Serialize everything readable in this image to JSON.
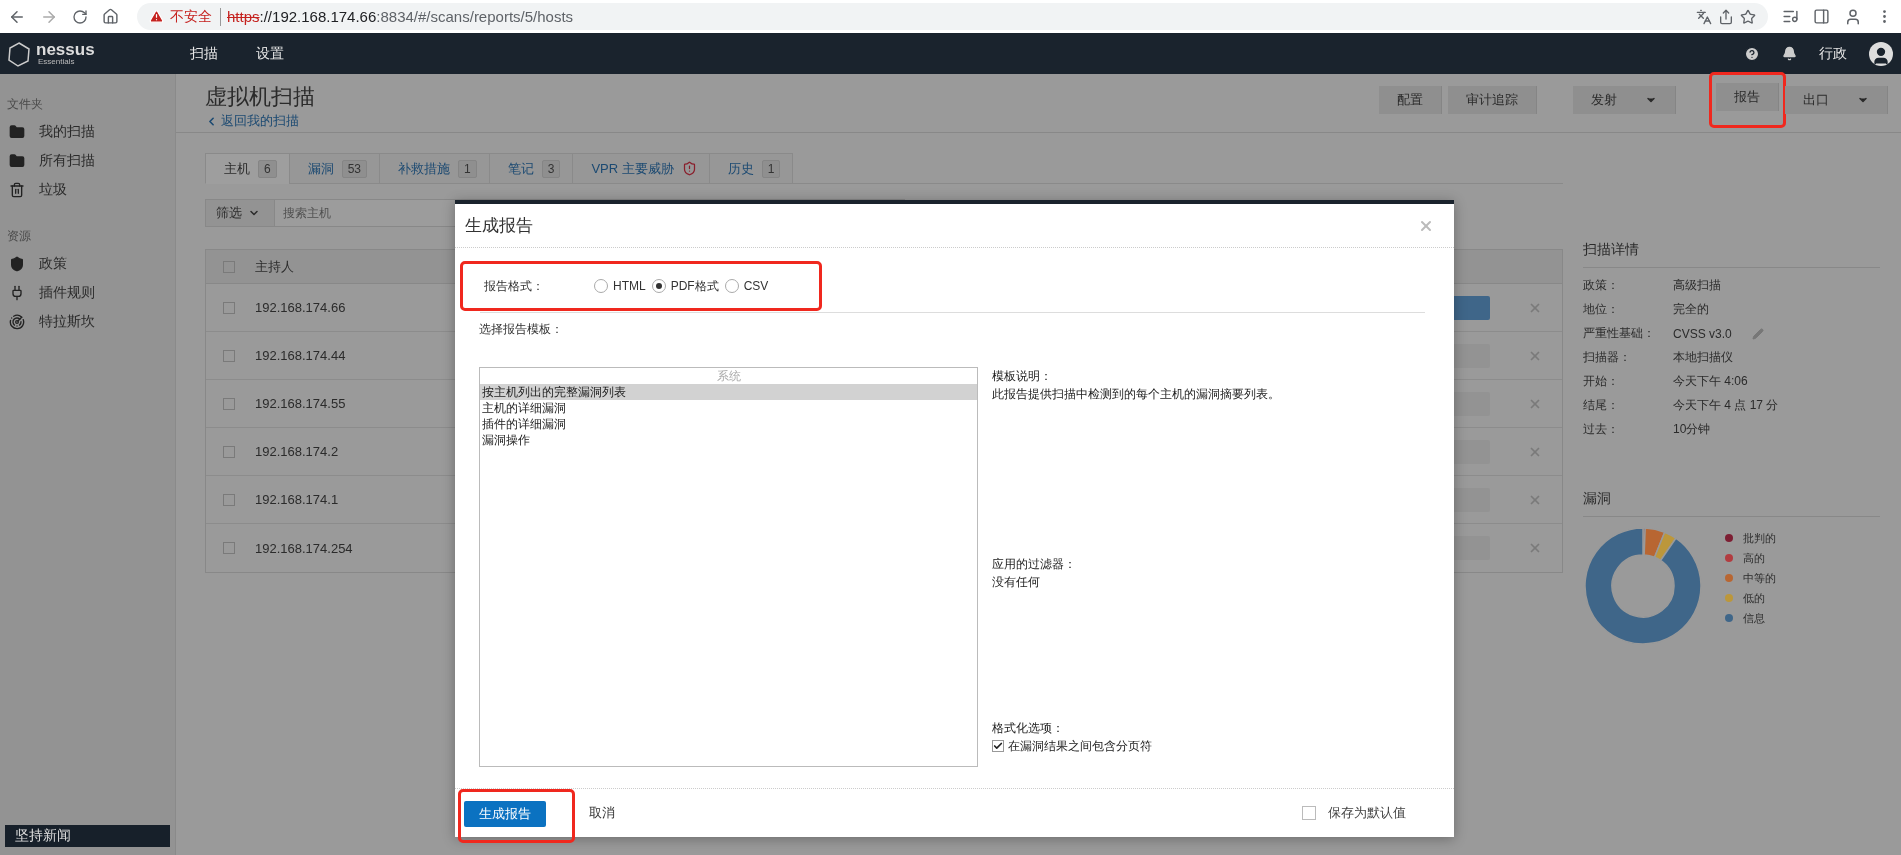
{
  "browser": {
    "security": "不安全",
    "url_parts": [
      {
        "kind": "scheme",
        "text": "https"
      },
      {
        "kind": "host",
        "text": "://192.168.174.66"
      },
      {
        "kind": "path",
        "text": ":8834/#/scans/reports/5/hosts"
      }
    ]
  },
  "nav": {
    "logo": "nessus",
    "logo_sub": "Essentials",
    "items": [
      "扫描",
      "设置"
    ],
    "user": "行政"
  },
  "sidebar": {
    "sections": [
      {
        "title": "文件夹",
        "items": [
          {
            "label": "我的扫描",
            "kind": "folder"
          },
          {
            "label": "所有扫描",
            "kind": "folder"
          },
          {
            "label": "垃圾",
            "kind": "trash"
          }
        ]
      },
      {
        "title": "资源",
        "items": [
          {
            "label": "政策",
            "kind": "policy"
          },
          {
            "label": "插件规则",
            "kind": "plugin"
          },
          {
            "label": "特拉斯坎",
            "kind": "radar"
          }
        ]
      }
    ],
    "news": "坚持新闻"
  },
  "header": {
    "title": "虚拟机扫描",
    "back": "返回我的扫描",
    "action_groups": [
      [
        {
          "label": "配置",
          "dropdown": false,
          "highlighted": false
        },
        {
          "label": "审计追踪",
          "dropdown": false,
          "highlighted": false
        }
      ],
      [
        {
          "label": "发射",
          "dropdown": true,
          "highlighted": false
        }
      ],
      [
        {
          "label": "报告",
          "dropdown": false,
          "highlighted": true
        },
        {
          "label": "出口",
          "dropdown": true,
          "highlighted": false
        }
      ]
    ]
  },
  "tabs": [
    {
      "label": "主机",
      "kind": "count",
      "count": "6",
      "selected": true
    },
    {
      "label": "漏洞",
      "kind": "count",
      "count": "53",
      "selected": false
    },
    {
      "label": "补救措施",
      "kind": "count",
      "count": "1",
      "selected": false
    },
    {
      "label": "笔记",
      "kind": "count",
      "count": "3",
      "selected": false
    },
    {
      "label": "VPR 主要威胁",
      "kind": "alert",
      "selected": false
    },
    {
      "label": "历史",
      "kind": "count",
      "count": "1",
      "selected": false
    }
  ],
  "filter": {
    "button": "筛选",
    "placeholder": "搜索主机"
  },
  "table": {
    "columns": [
      "主持人"
    ],
    "header_checked": false,
    "rows": [
      {
        "host": "192.168.174.66",
        "checked": false,
        "level": 1
      },
      {
        "host": "192.168.174.44",
        "checked": false,
        "level": 0
      },
      {
        "host": "192.168.174.55",
        "checked": false,
        "level": 0
      },
      {
        "host": "192.168.174.2",
        "checked": false,
        "level": 0
      },
      {
        "host": "192.168.174.1",
        "checked": false,
        "level": 0
      },
      {
        "host": "192.168.174.254",
        "checked": false,
        "level": 0
      }
    ]
  },
  "scan_details": {
    "title": "扫描详情",
    "rows": [
      {
        "label": "政策：",
        "value": "高级扫描",
        "editable": false
      },
      {
        "label": "地位：",
        "value": "完全的",
        "editable": false
      },
      {
        "label": "严重性基础：",
        "value": "CVSS v3.0",
        "editable": true
      },
      {
        "label": "扫描器：",
        "value": "本地扫描仪",
        "editable": false
      },
      {
        "label": "开始：",
        "value": "今天下午 4:06",
        "editable": false
      },
      {
        "label": "结尾：",
        "value": "今天下午 4 点 17 分",
        "editable": false
      },
      {
        "label": "过去：",
        "value": "10分钟",
        "editable": false
      }
    ]
  },
  "vulnerabilities": {
    "title": "漏洞",
    "legend": [
      {
        "label": "批判的",
        "color": "#7d1e33"
      },
      {
        "label": "高的",
        "color": "#b23c40"
      },
      {
        "label": "中等的",
        "color": "#b86632"
      },
      {
        "label": "低的",
        "color": "#bc973b"
      },
      {
        "label": "信息",
        "color": "#3f6689"
      }
    ]
  },
  "modal": {
    "title": "生成报告",
    "format": {
      "label": "报告格式：",
      "highlighted": true,
      "options": [
        {
          "label": "HTML",
          "selected": false
        },
        {
          "label": "PDF格式",
          "selected": true
        },
        {
          "label": "CSV",
          "selected": false
        }
      ]
    },
    "template_label": "选择报告模板：",
    "template_group": "系统",
    "templates": [
      {
        "label": "按主机列出的完整漏洞列表",
        "selected": true
      },
      {
        "label": "主机的详细漏洞",
        "selected": false
      },
      {
        "label": "插件的详细漏洞",
        "selected": false
      },
      {
        "label": "漏洞操作",
        "selected": false
      }
    ],
    "description_label": "模板说明：",
    "description": "此报告提供扫描中检测到的每个主机的漏洞摘要列表。",
    "filters_label": "应用的过滤器：",
    "filters": "没有任何",
    "options_label": "格式化选项：",
    "options": [
      {
        "label": "在漏洞结果之间包含分页符",
        "checked": true
      }
    ],
    "submit": {
      "label": "生成报告",
      "highlighted": true
    },
    "cancel": "取消",
    "save_default": {
      "label": "保存为默认值",
      "checked": false
    }
  }
}
